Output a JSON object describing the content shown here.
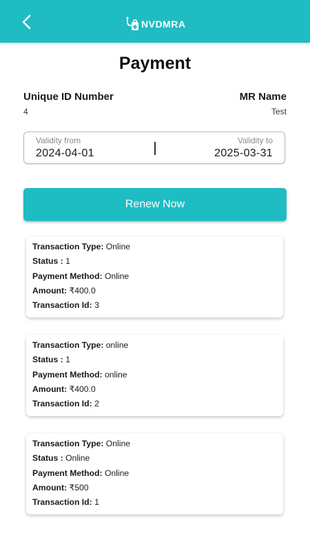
{
  "header": {
    "brand_name": "NVDMRA",
    "colors": {
      "primary": "#1fbcc3",
      "on_primary": "#ffffff"
    },
    "back_icon": "chevron-left-icon",
    "logo_icon": "stethoscope-bag-icon"
  },
  "page": {
    "title": "Payment"
  },
  "member": {
    "unique_id_label": "Unique ID Number",
    "unique_id_value": "4",
    "mr_name_label": "MR Name",
    "mr_name_value": "Test"
  },
  "validity": {
    "from_label": "Validity from",
    "from_value": "2024-04-01",
    "to_label": "Validity to",
    "to_value": "2025-03-31"
  },
  "renew_button": {
    "label": "Renew Now"
  },
  "field_labels": {
    "transaction_type": "Transaction Type:",
    "status": "Status :",
    "payment_method": "Payment Method:",
    "amount": "Amount:",
    "transaction_id": "Transaction Id:"
  },
  "transactions": [
    {
      "transaction_type": "Online",
      "status": "1",
      "payment_method": "Online",
      "amount": "₹400.0",
      "transaction_id": "3"
    },
    {
      "transaction_type": "online",
      "status": "1",
      "payment_method": "online",
      "amount": "₹400.0",
      "transaction_id": "2"
    },
    {
      "transaction_type": "Online",
      "status": "Online",
      "payment_method": "Online",
      "amount": "₹500",
      "transaction_id": "1"
    }
  ]
}
